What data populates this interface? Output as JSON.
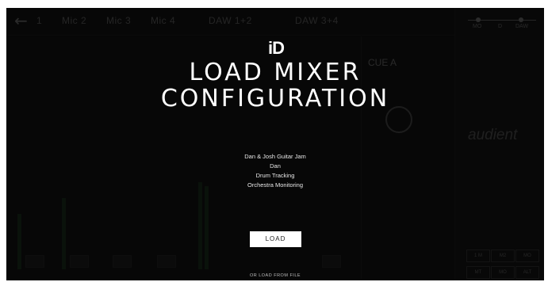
{
  "mixer": {
    "back_icon": "arrow-left-icon",
    "channel_tabs": [
      "1",
      "Mic 2",
      "Mic 3",
      "Mic 4",
      "DAW 1+2",
      "DAW 3+4"
    ],
    "cue_label": "CUE A",
    "brand": "audient",
    "brand_sub": "iD",
    "scale_ticks": [
      "MO",
      "D",
      "DAW"
    ],
    "panel_buttons": [
      "1 M",
      "M2",
      "MO",
      "MT",
      "MO",
      "ALT"
    ]
  },
  "modal": {
    "logo": "iD",
    "title_line1": "LOAD MIXER",
    "title_line2": "CONFIGURATION",
    "configurations": [
      "Dan & Josh Guitar Jam",
      "Dan",
      "Drum Tracking",
      "Orchestra Monitoring"
    ],
    "load_label": "LOAD",
    "load_from_file_label": "OR LOAD FROM FILE"
  }
}
